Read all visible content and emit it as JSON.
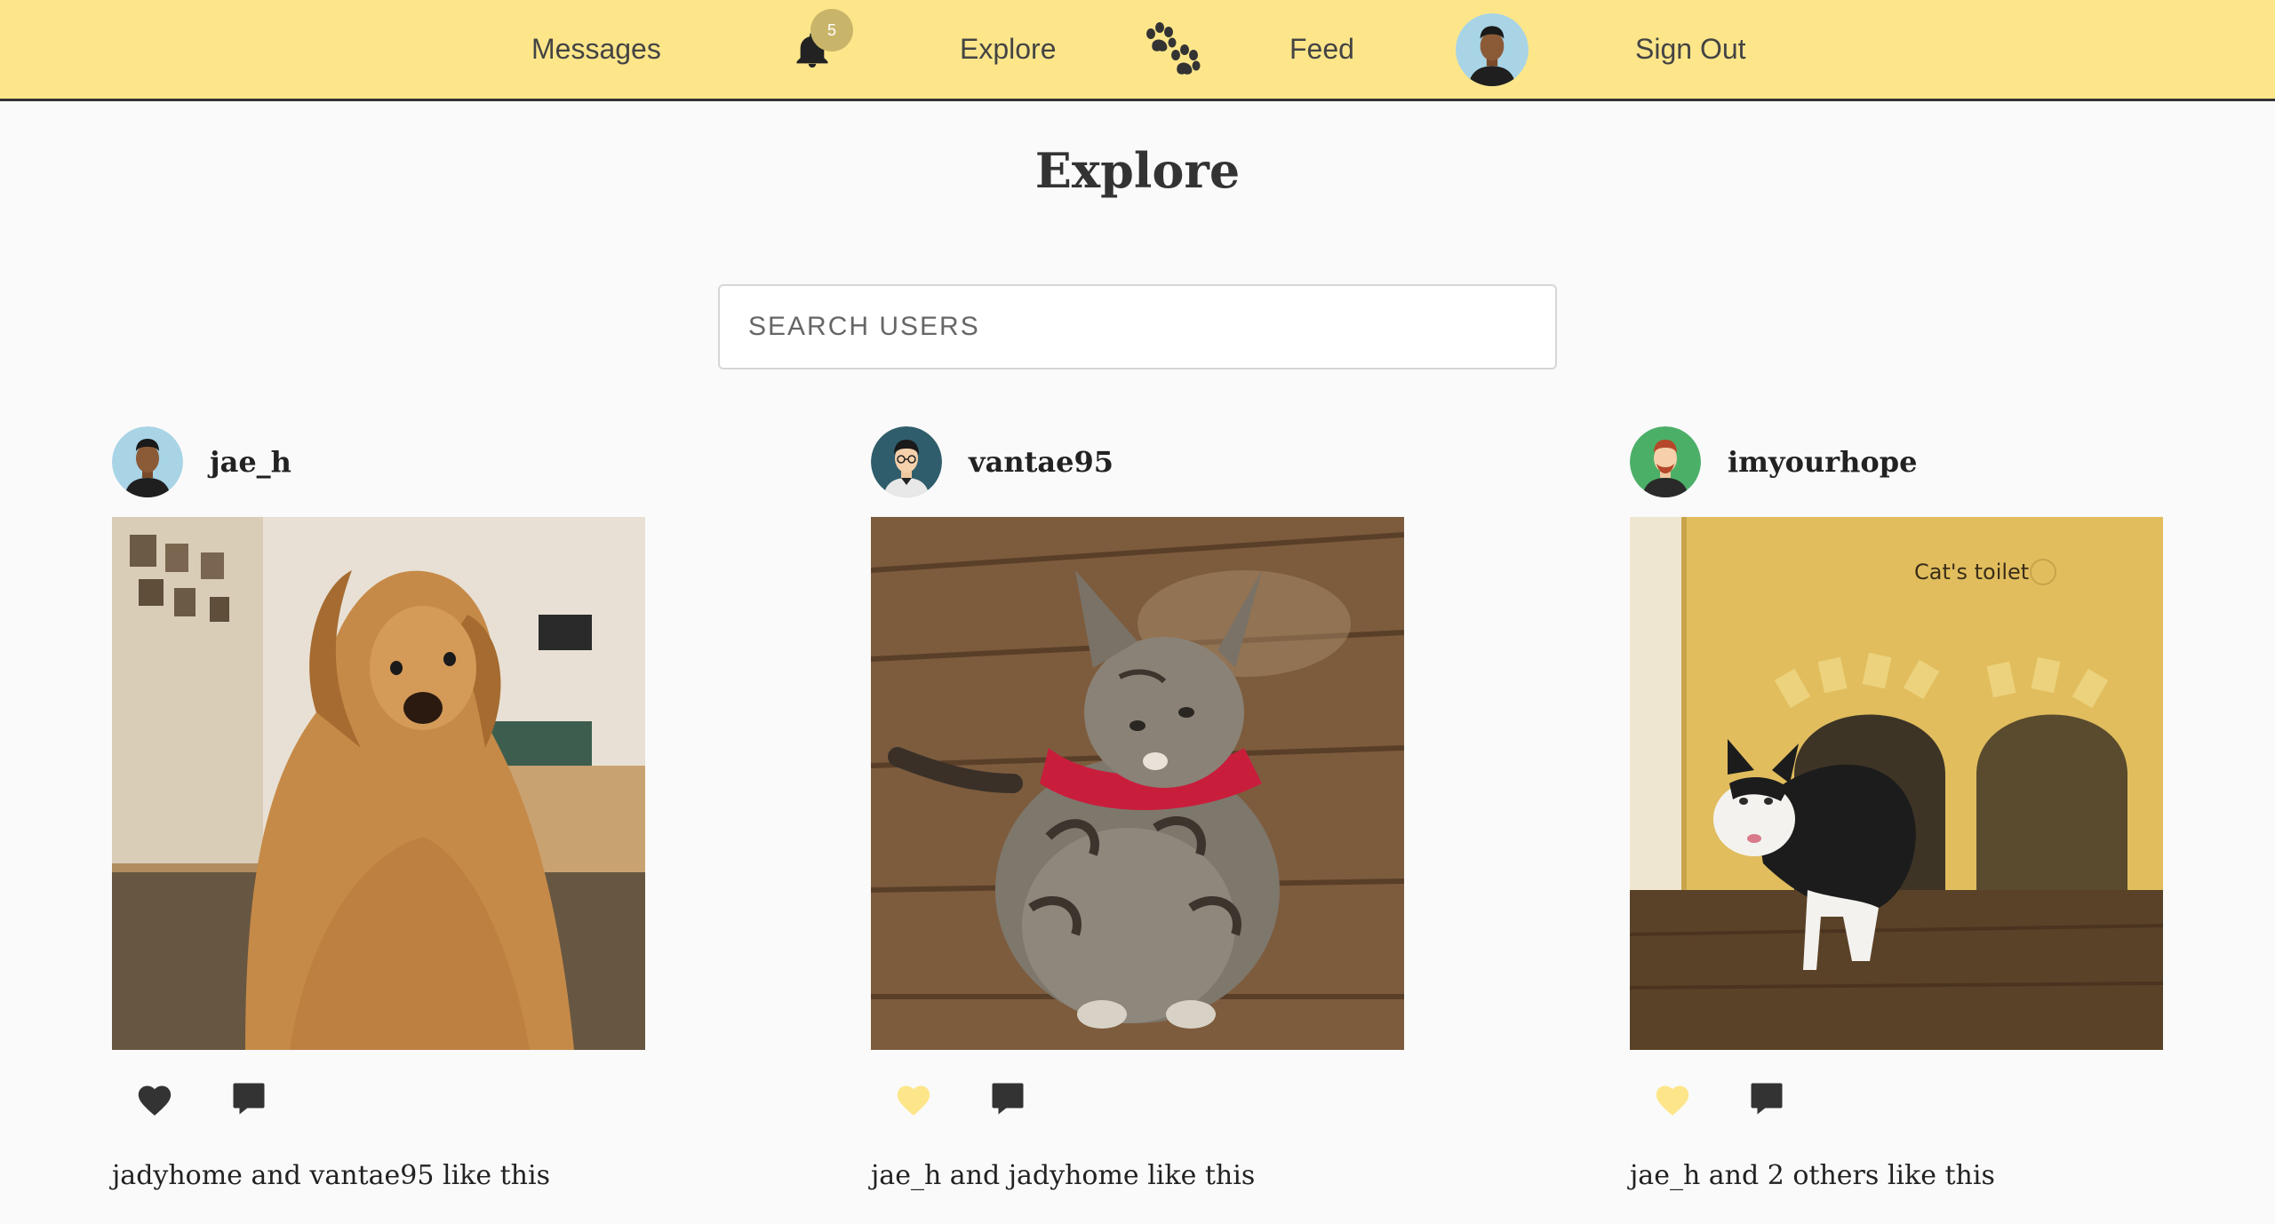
{
  "nav": {
    "messages_label": "Messages",
    "notification_count": "5",
    "explore_label": "Explore",
    "feed_label": "Feed",
    "signout_label": "Sign Out"
  },
  "main": {
    "title": "Explore",
    "search_placeholder": "SEARCH USERS"
  },
  "posts": [
    {
      "username": "jae_h",
      "likes_text": "jadyhome and vantae95 like this",
      "liked": true,
      "avatar_bg": "#a8d4e6",
      "image_subject": "golden retriever in cafe"
    },
    {
      "username": "vantae95",
      "likes_text": "jae_h and jadyhome like this",
      "liked": false,
      "avatar_bg": "#2f5d6b",
      "image_subject": "tabby cat with red bandana on wood floor"
    },
    {
      "username": "imyourhope",
      "likes_text": "jae_h and 2 others like this",
      "liked": false,
      "avatar_bg": "#4caf68",
      "image_subject": "black and white cat exiting cat house"
    }
  ],
  "colors": {
    "navbar_bg": "#fde68a",
    "heart_liked": "#333333",
    "heart_unliked": "#fde68a",
    "page_bg": "#fafafa"
  }
}
